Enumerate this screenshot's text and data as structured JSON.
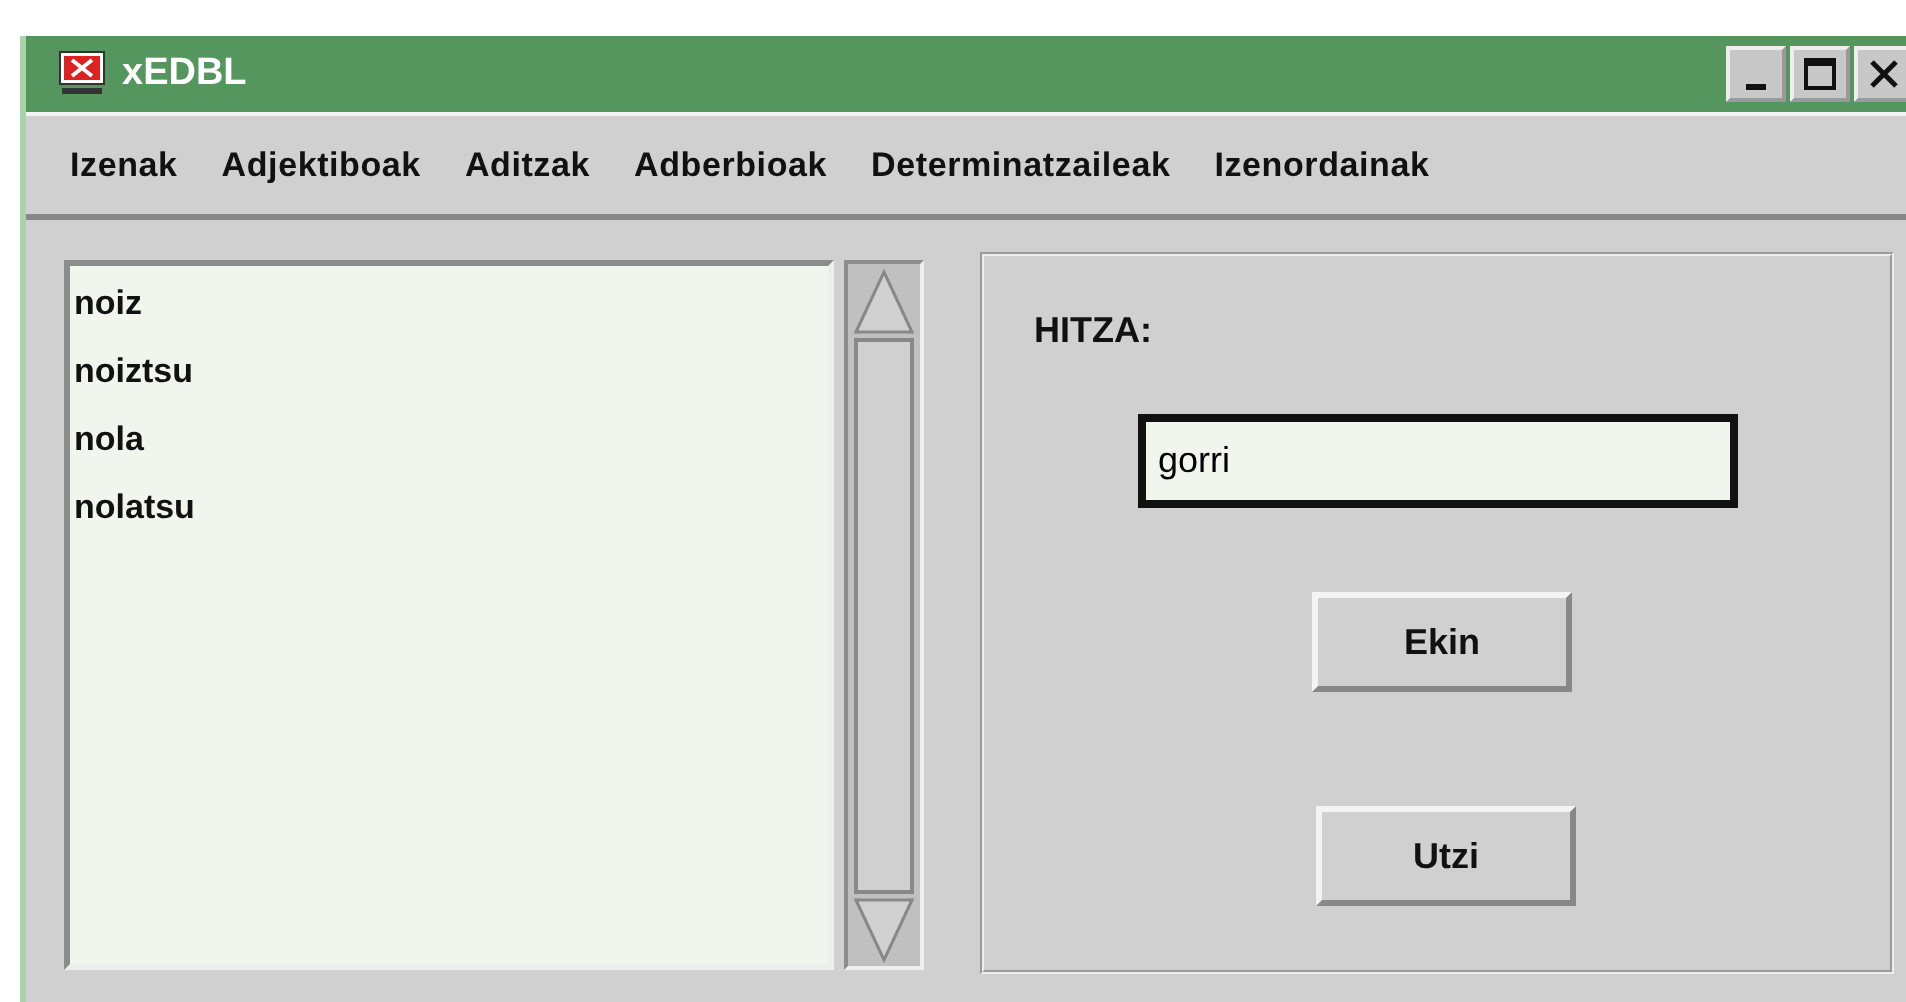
{
  "window": {
    "title": "xEDBL"
  },
  "menu": [
    "Izenak",
    "Adjektiboak",
    "Aditzak",
    "Adberbioak",
    "Determinatzaileak",
    "Izenordainak"
  ],
  "list": {
    "items": [
      "noiz",
      "noiztsu",
      "nola",
      "nolatsu"
    ]
  },
  "form": {
    "label": "HITZA:",
    "value": "gorri",
    "focused": true
  },
  "buttons": [
    "Ekin",
    "Utzi"
  ]
}
